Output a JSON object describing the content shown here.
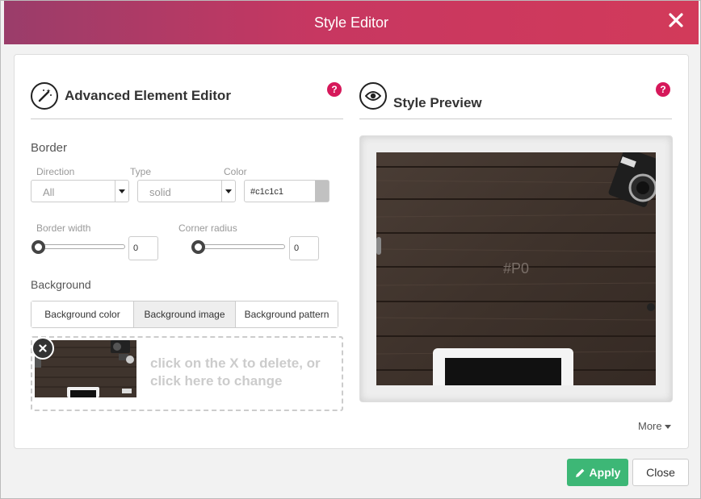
{
  "window": {
    "title": "Style Editor"
  },
  "editor": {
    "title": "Advanced Element Editor",
    "help": "?",
    "border": {
      "section_label": "Border",
      "direction_label": "Direction",
      "direction_value": "All",
      "type_label": "Type",
      "type_value": "solid",
      "color_label": "Color",
      "color_value": "#c1c1c1",
      "width_label": "Border width",
      "width_value": "0",
      "radius_label": "Corner radius",
      "radius_value": "0"
    },
    "background": {
      "section_label": "Background",
      "tabs": [
        "Background color",
        "Background image",
        "Background pattern"
      ],
      "active_tab": 1,
      "dropzone_text": "click on the X to delete, or click here to change"
    }
  },
  "preview": {
    "title": "Style Preview",
    "help": "?",
    "element_label": "#P0",
    "more_label": "More"
  },
  "footer": {
    "apply_label": "Apply",
    "close_label": "Close"
  },
  "colors": {
    "header_start": "#9a3d6a",
    "header_end": "#d23a5a",
    "help": "#d6185a",
    "apply": "#3db776",
    "border_swatch": "#c1c1c1"
  }
}
